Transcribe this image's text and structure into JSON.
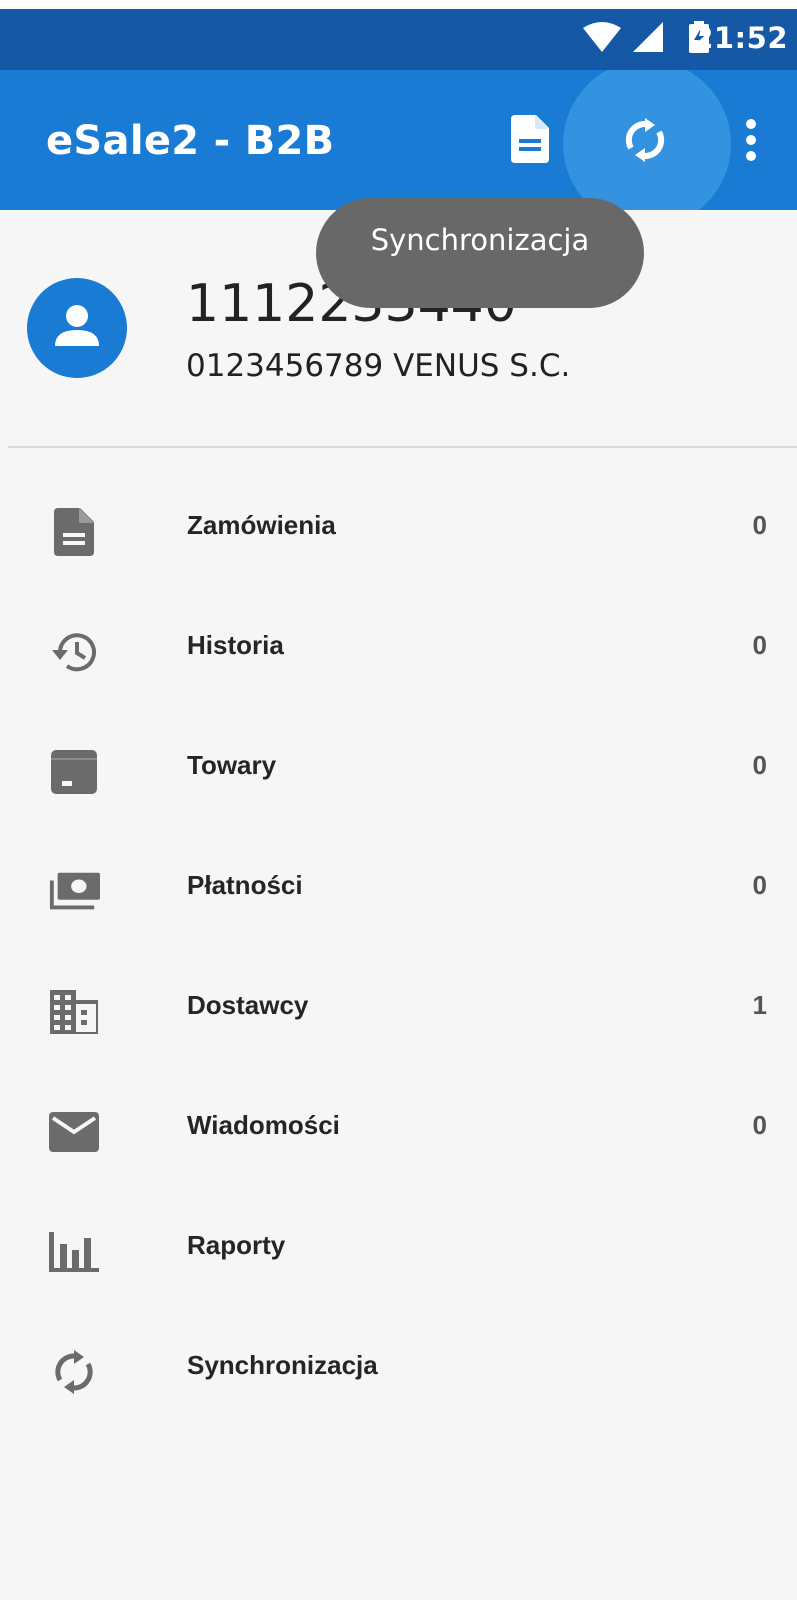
{
  "status_bar": {
    "time": "21:52",
    "icons": [
      "wifi-icon",
      "signal-icon",
      "battery-charging-icon"
    ]
  },
  "app_bar": {
    "title": "eSale2 - B2B",
    "actions": [
      "document-icon",
      "sync-icon",
      "more-vert-icon"
    ],
    "accent": "#1a7bd4"
  },
  "toast": {
    "text": "Synchronizacja"
  },
  "profile": {
    "user_id": "1112233440",
    "company": "0123456789 VENUS S.C."
  },
  "menu": {
    "items": [
      {
        "label": "Zamówienia",
        "count": "0",
        "icon": "document-icon"
      },
      {
        "label": "Historia",
        "count": "0",
        "icon": "history-icon"
      },
      {
        "label": "Towary",
        "count": "0",
        "icon": "box-icon"
      },
      {
        "label": "Płatności",
        "count": "0",
        "icon": "payments-icon"
      },
      {
        "label": "Dostawcy",
        "count": "1",
        "icon": "building-icon"
      },
      {
        "label": "Wiadomości",
        "count": "0",
        "icon": "mail-icon"
      },
      {
        "label": "Raporty",
        "count": "",
        "icon": "chart-icon"
      },
      {
        "label": "Synchronizacja",
        "count": "",
        "icon": "sync-icon"
      }
    ]
  }
}
